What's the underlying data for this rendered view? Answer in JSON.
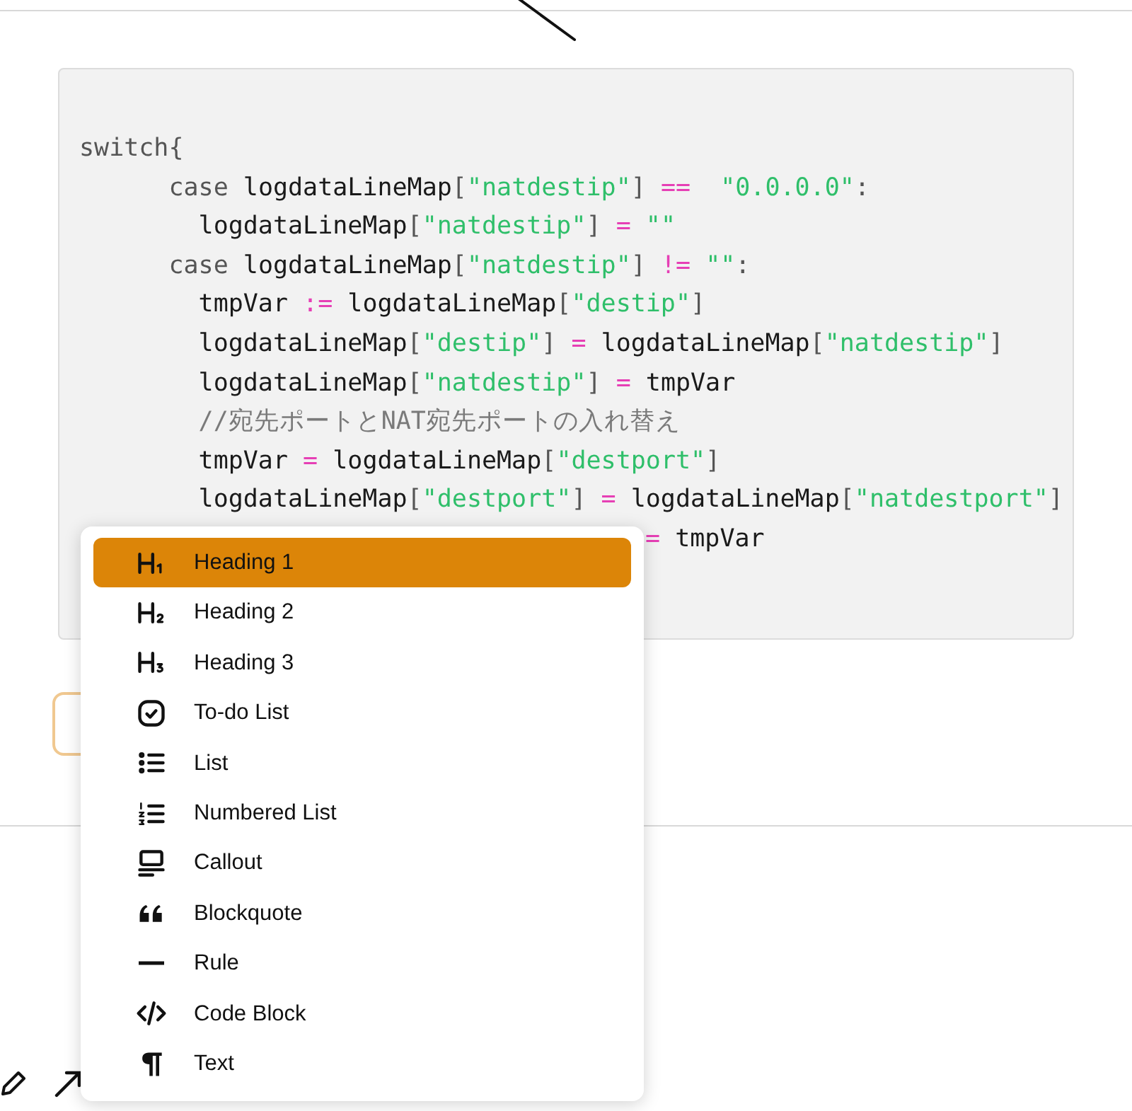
{
  "code_block": {
    "lines": [
      {
        "kind": "full",
        "tokens": [
          {
            "kind": "kw",
            "text": "switch{"
          }
        ]
      },
      {
        "kind": "full",
        "tokens": [
          {
            "kind": "kw",
            "text": "      case "
          },
          {
            "kind": "id",
            "text": "logdataLineMap"
          },
          {
            "kind": "p",
            "text": "["
          },
          {
            "kind": "str",
            "text": "\"natdestip\""
          },
          {
            "kind": "p",
            "text": "] "
          },
          {
            "kind": "op",
            "text": "=="
          },
          {
            "kind": "str",
            "text": "  \"0.0.0.0\""
          },
          {
            "kind": "p",
            "text": ":"
          }
        ]
      },
      {
        "kind": "full",
        "tokens": [
          {
            "kind": "id",
            "text": "        logdataLineMap"
          },
          {
            "kind": "p",
            "text": "["
          },
          {
            "kind": "str",
            "text": "\"natdestip\""
          },
          {
            "kind": "p",
            "text": "] "
          },
          {
            "kind": "op",
            "text": "="
          },
          {
            "kind": "str",
            "text": " \"\""
          }
        ]
      },
      {
        "kind": "full",
        "tokens": [
          {
            "kind": "kw",
            "text": "      case "
          },
          {
            "kind": "id",
            "text": "logdataLineMap"
          },
          {
            "kind": "p",
            "text": "["
          },
          {
            "kind": "str",
            "text": "\"natdestip\""
          },
          {
            "kind": "p",
            "text": "] "
          },
          {
            "kind": "op",
            "text": "!="
          },
          {
            "kind": "str",
            "text": " \"\""
          },
          {
            "kind": "p",
            "text": ":"
          }
        ]
      },
      {
        "kind": "full",
        "tokens": [
          {
            "kind": "id",
            "text": "        tmpVar "
          },
          {
            "kind": "op",
            "text": ":="
          },
          {
            "kind": "id",
            "text": " logdataLineMap"
          },
          {
            "kind": "p",
            "text": "["
          },
          {
            "kind": "str",
            "text": "\"destip\""
          },
          {
            "kind": "p",
            "text": "]"
          }
        ]
      },
      {
        "kind": "full",
        "tokens": [
          {
            "kind": "id",
            "text": "        logdataLineMap"
          },
          {
            "kind": "p",
            "text": "["
          },
          {
            "kind": "str",
            "text": "\"destip\""
          },
          {
            "kind": "p",
            "text": "] "
          },
          {
            "kind": "op",
            "text": "="
          },
          {
            "kind": "id",
            "text": " logdataLineMap"
          },
          {
            "kind": "p",
            "text": "["
          },
          {
            "kind": "str",
            "text": "\"natdestip\""
          },
          {
            "kind": "p",
            "text": "]"
          }
        ]
      },
      {
        "kind": "full",
        "tokens": [
          {
            "kind": "id",
            "text": "        logdataLineMap"
          },
          {
            "kind": "p",
            "text": "["
          },
          {
            "kind": "str",
            "text": "\"natdestip\""
          },
          {
            "kind": "p",
            "text": "] "
          },
          {
            "kind": "op",
            "text": "="
          },
          {
            "kind": "id",
            "text": " tmpVar"
          }
        ]
      },
      {
        "kind": "full",
        "tokens": [
          {
            "kind": "cm",
            "text": "        //宛先ポートとNAT宛先ポートの入れ替え"
          }
        ]
      },
      {
        "kind": "full",
        "tokens": [
          {
            "kind": "id",
            "text": "        tmpVar "
          },
          {
            "kind": "op",
            "text": "="
          },
          {
            "kind": "id",
            "text": " logdataLineMap"
          },
          {
            "kind": "p",
            "text": "["
          },
          {
            "kind": "str",
            "text": "\"destport\""
          },
          {
            "kind": "p",
            "text": "]"
          }
        ]
      },
      {
        "kind": "full",
        "tokens": [
          {
            "kind": "id",
            "text": "        logdataLineMap"
          },
          {
            "kind": "p",
            "text": "["
          },
          {
            "kind": "str",
            "text": "\"destport\""
          },
          {
            "kind": "p",
            "text": "] "
          },
          {
            "kind": "op",
            "text": "="
          },
          {
            "kind": "id",
            "text": " logdataLineMap"
          },
          {
            "kind": "p",
            "text": "["
          },
          {
            "kind": "str",
            "text": "\"natdestport\""
          },
          {
            "kind": "p",
            "text": "]"
          }
        ]
      },
      {
        "kind": "covered",
        "tokens": [
          {
            "kind": "op",
            "text": "="
          },
          {
            "kind": "id",
            "text": " tmpVar"
          }
        ]
      }
    ]
  },
  "block_menu": {
    "items": [
      {
        "kind": "h1",
        "label": "Heading 1",
        "selected": true
      },
      {
        "kind": "h2",
        "label": "Heading 2",
        "selected": false
      },
      {
        "kind": "h3",
        "label": "Heading 3",
        "selected": false
      },
      {
        "kind": "todo",
        "label": "To-do List",
        "selected": false
      },
      {
        "kind": "list",
        "label": "List",
        "selected": false
      },
      {
        "kind": "numbered",
        "label": "Numbered List",
        "selected": false
      },
      {
        "kind": "callout",
        "label": "Callout",
        "selected": false
      },
      {
        "kind": "quote",
        "label": "Blockquote",
        "selected": false
      },
      {
        "kind": "rule",
        "label": "Rule",
        "selected": false
      },
      {
        "kind": "code",
        "label": "Code Block",
        "selected": false
      },
      {
        "kind": "text",
        "label": "Text",
        "selected": false
      }
    ]
  }
}
